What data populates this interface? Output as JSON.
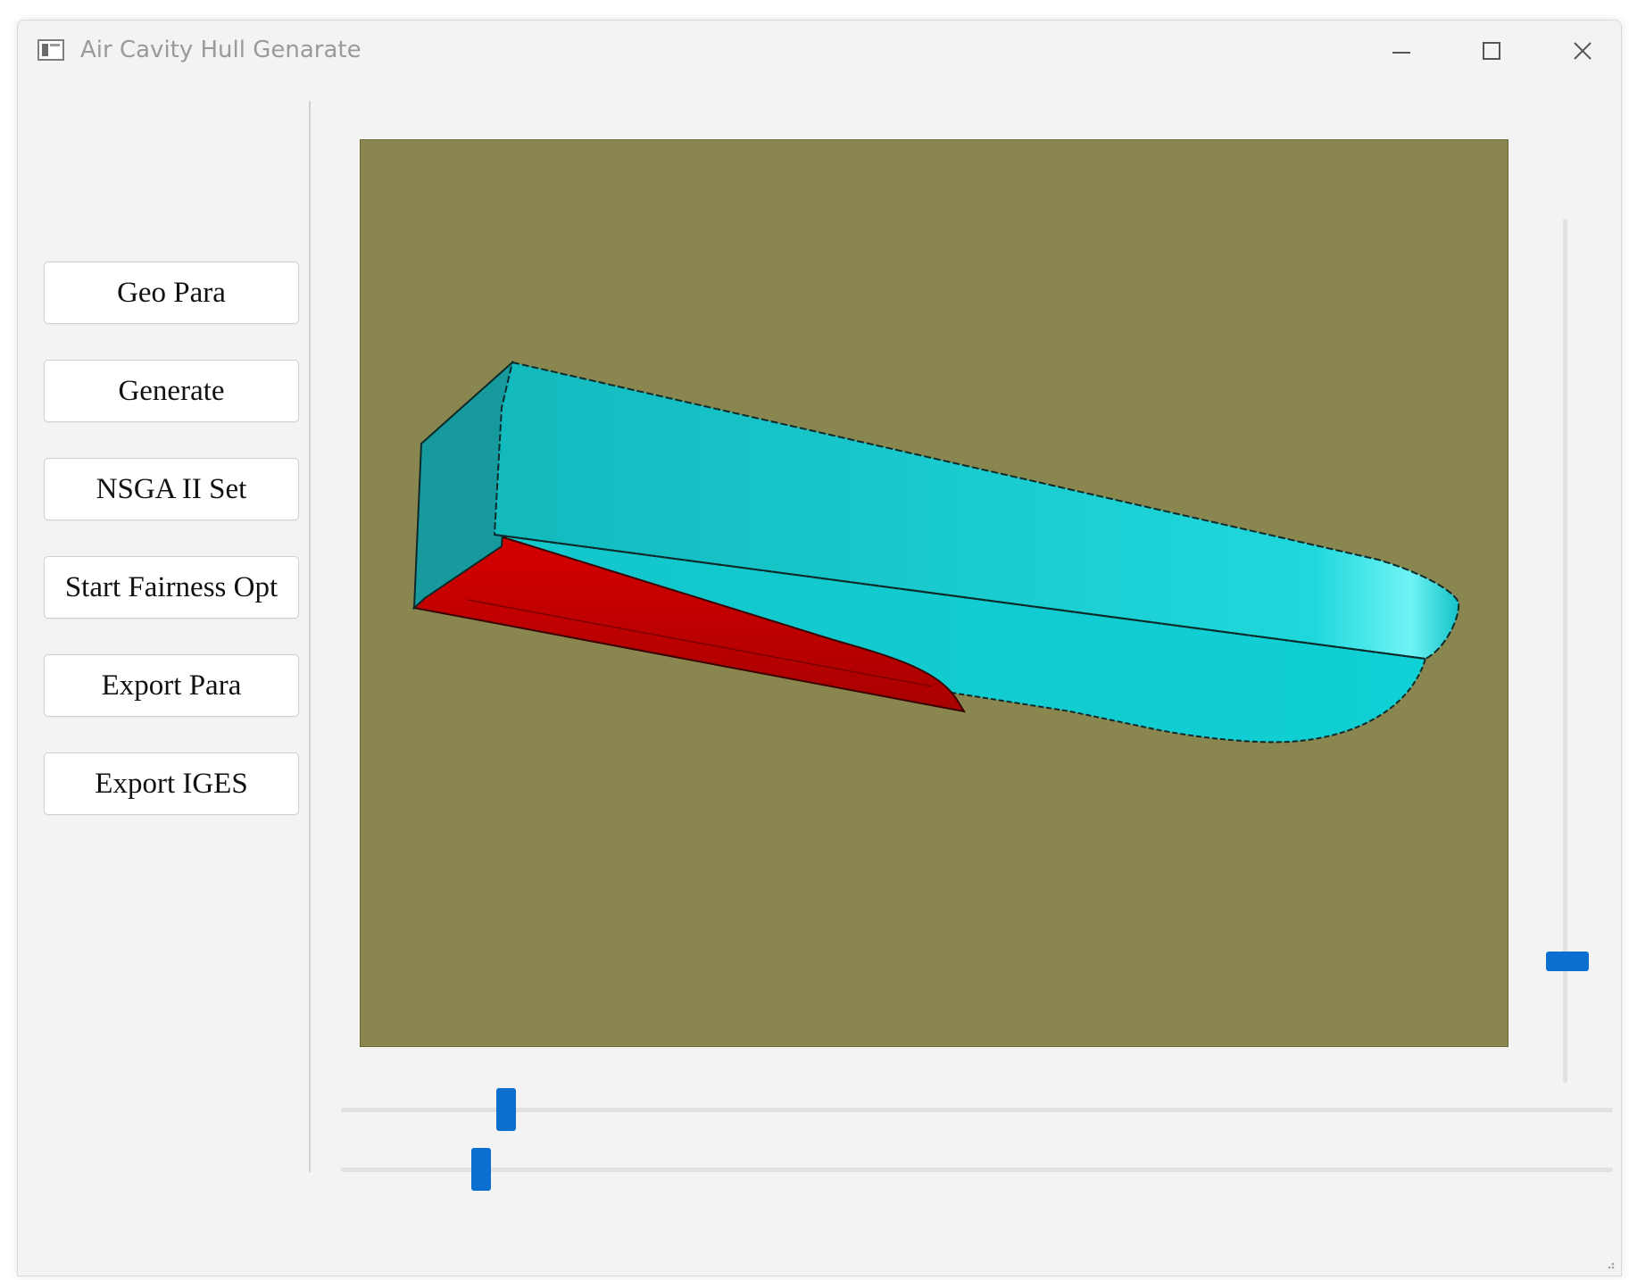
{
  "window": {
    "title": "Air Cavity Hull Genarate"
  },
  "left_panel": {
    "buttons": [
      {
        "label": "Geo Para"
      },
      {
        "label": "Generate"
      },
      {
        "label": "NSGA II Set"
      },
      {
        "label": "Start Fairness Opt"
      },
      {
        "label": "Export Para"
      },
      {
        "label": "Export IGES"
      }
    ]
  },
  "viewport": {
    "background_color": "#8a864f",
    "hull_color": "#18cfd3",
    "air_cavity_color": "#c40000"
  },
  "sliders": {
    "vertical": {
      "value_fraction": 0.11
    },
    "horizontal_1": {
      "value_fraction": 0.13
    },
    "horizontal_2": {
      "value_fraction": 0.11
    }
  },
  "accent_color": "#0a6fcf"
}
